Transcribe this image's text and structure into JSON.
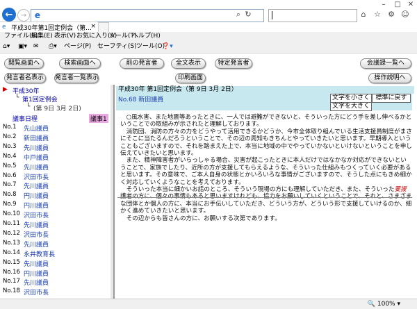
{
  "browser": {
    "address_url": "",
    "search_value": "",
    "tab_title": "平成30年第1回定例会（第...",
    "menu": [
      "ファイル(F)",
      "編集(E)",
      "表示(V)",
      "お気に入り(A)",
      "ツール(T)",
      "ヘルプ(H)"
    ],
    "commands": [
      "ページ(P)",
      "セーフティ(S)",
      "ツール(O)"
    ],
    "zoom": "100%"
  },
  "toolbar": {
    "top_page": "閲覧画面へ",
    "search_screen": "検索画面へ",
    "prev_speech": "前の発言者",
    "show_all": "全文表示",
    "specific_speaker": "特定発言者",
    "meeting_list": "会議録一覧へ",
    "show_speakers": "発言者名表示",
    "speaker_list": "発言者一覧表示",
    "print_screen": "印刷画面",
    "operation_help": "操作説明へ"
  },
  "left": {
    "tree_year": "平成30年",
    "tree_session": "第1回定例会",
    "tree_date": "(第 9日  3月 2日)",
    "list_header": "議事日程",
    "list_header_badge": "議事1",
    "rows": [
      {
        "num": "No.1",
        "name": "先山議員"
      },
      {
        "num": "No.2",
        "name": "新田議員"
      },
      {
        "num": "No.3",
        "name": "先川議員"
      },
      {
        "num": "No.4",
        "name": "中戸議員"
      },
      {
        "num": "No.5",
        "name": "先川議員"
      },
      {
        "num": "No.6",
        "name": "沢田市長"
      },
      {
        "num": "No.7",
        "name": "先川議員"
      },
      {
        "num": "No.8",
        "name": "円川議員"
      },
      {
        "num": "No.9",
        "name": "円川議員"
      },
      {
        "num": "No.10",
        "name": "沢田市長"
      },
      {
        "num": "No.11",
        "name": "先川議員"
      },
      {
        "num": "No.12",
        "name": "沢田市長"
      },
      {
        "num": "No.13",
        "name": "先川議員"
      },
      {
        "num": "No.14",
        "name": "永井教育長"
      },
      {
        "num": "No.15",
        "name": "先川議員"
      },
      {
        "num": "No.16",
        "name": "円川議員"
      },
      {
        "num": "No.17",
        "name": "先川議員"
      },
      {
        "num": "No.18",
        "name": "沢田市長"
      }
    ]
  },
  "main": {
    "meeting_title": "平成30年 第1回定例会（第 9日  3月 2日）",
    "speaker": "No.68 新田議員",
    "font_small": "文字を小さく",
    "font_reset": "標準に戻す",
    "font_large": "文字を大きく",
    "speech_lines": [
      "　○風水害、また地震等あったときに、一人では避難ができないと、そういった方にどう手を差し伸べるかということでの取組みが示されたと理解しております。",
      "　消防団、消防の方々の力をどうやって活用できるかどうか、今市全体取り組んでいる生活支援員制度がまさにそこに当たるんだろうということで、その辺の周知もきちんとやっていきたいと思います。早期導入ということもございますので、それを踏まえた上で、本当に地域の中でやっていかないといけないということを申し伝えていきたいと思います。",
      "　また、精神障害者がいらっしゃる場合、災害が起こったときに本人だけではなかなか対応ができないということで、家族でしたり、近所の方が支援してもらえるような、そういった仕組みもつくっていく必要があると思います。その意味で、ご本人自身の状態とかいろいろな事情がございますので、そうした点にもきめ細かく対応していくようなことを考えております。",
      "　そういった本当に細かいお話のところ、そういう現場の方にも理解していただき、また、そういった要援護者の方に、個々の事情もあると思いますけれども、協力をお願いしていくということで、それと、さまざまな団体とか個人の方に、本当にお手伝いしていただき、どういう方が、どういう形で支援していけるのか、細かく進めていきたいと思います。",
      "　その辺からも皆さんの方に、お願いする次第であります。"
    ],
    "highlight_word": "要援"
  }
}
